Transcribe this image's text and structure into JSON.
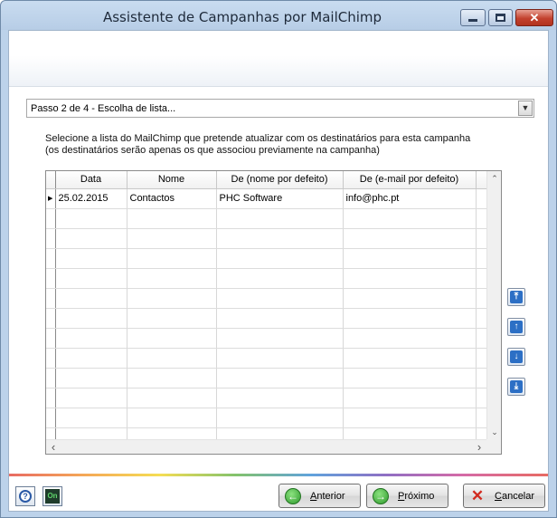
{
  "window": {
    "title": "Assistente de Campanhas por MailChimp",
    "min_glyph": "—",
    "max_glyph": "□",
    "close_glyph": "✕"
  },
  "step": {
    "selected": "Passo 2 de 4 - Escolha de lista...",
    "drop_glyph": "▼"
  },
  "instructions": {
    "line1": "Selecione a lista do MailChimp que pretende atualizar com os destinatários para esta campanha",
    "line2": "(os destinatários serão apenas os que associou previamente na campanha)"
  },
  "grid": {
    "columns": [
      "Data",
      "Nome",
      "De (nome por defeito)",
      "De (e-mail por defeito)"
    ],
    "rows": [
      {
        "data": "25.02.2015",
        "nome": "Contactos",
        "de_nome": "PHC Software",
        "de_email": "info@phc.pt"
      }
    ],
    "row_indicator": "▶",
    "scroll_up": "⌃",
    "scroll_down": "⌄",
    "scroll_left": "‹",
    "scroll_right": "›"
  },
  "side_buttons": [
    {
      "name": "move-top",
      "glyph": "⤒"
    },
    {
      "name": "move-up",
      "glyph": "↑"
    },
    {
      "name": "move-down",
      "glyph": "↓"
    },
    {
      "name": "move-bottom",
      "glyph": "⤓"
    }
  ],
  "footer": {
    "help_glyph": "?",
    "on_glyph": "On",
    "back": {
      "pre": "",
      "acc": "A",
      "post": "nterior",
      "glyph": "←"
    },
    "next": {
      "pre": "",
      "acc": "P",
      "post": "róximo",
      "glyph": "→"
    },
    "cancel": {
      "pre": "",
      "acc": "C",
      "post": "ancelar",
      "glyph": "✕"
    }
  }
}
